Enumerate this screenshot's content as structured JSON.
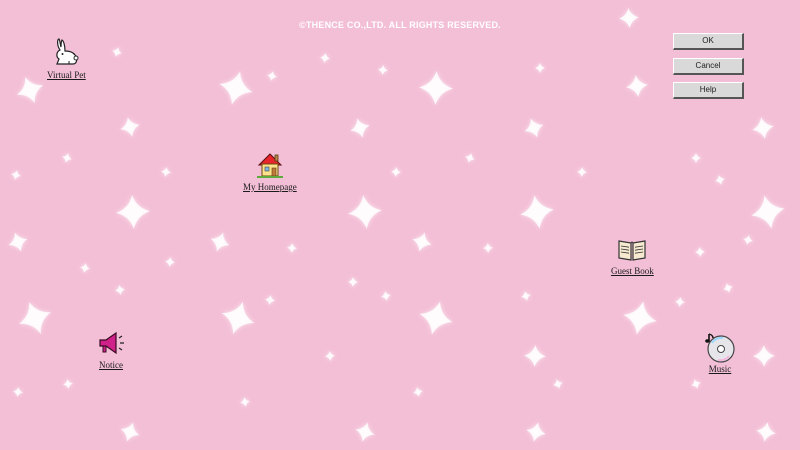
{
  "copyright": "©THENCE CO.,LTD. ALL RIGHTS RESERVED.",
  "dialog_buttons": {
    "ok": "OK",
    "cancel": "Cancel",
    "help": "Help"
  },
  "desktop_icons": {
    "virtual_pet": {
      "label": "Virtual Pet",
      "icon": "rabbit-icon"
    },
    "my_homepage": {
      "label": "My Homepage",
      "icon": "house-icon"
    },
    "guest_book": {
      "label": "Guest Book",
      "icon": "book-icon"
    },
    "notice": {
      "label": "Notice",
      "icon": "megaphone-icon"
    },
    "music": {
      "label": "Music",
      "icon": "cd-icon"
    }
  },
  "colors": {
    "background": "#f3bfd6",
    "stars": "#ffffff",
    "button_face": "#d9d9d9"
  }
}
